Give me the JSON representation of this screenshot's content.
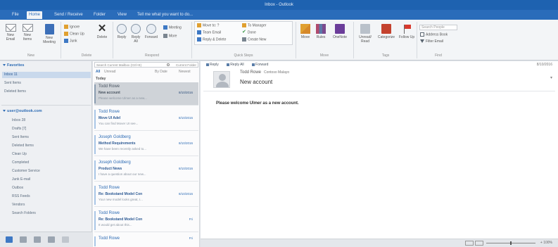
{
  "window": {
    "title": "Inbox - Outlook"
  },
  "tabs": [
    "File",
    "Home",
    "Send / Receive",
    "Folder",
    "View",
    "Tell me what you want to do..."
  ],
  "ribbon": {
    "new_email": "New Email",
    "new_items": "New Items",
    "new_meeting": "New Meeting",
    "ignore": "Ignore",
    "clean_up": "Clean Up",
    "junk": "Junk",
    "delete": "Delete",
    "reply": "Reply",
    "reply_all": "Reply All",
    "forward": "Forward",
    "meeting": "Meeting",
    "more": "More",
    "move_to": "Move to: ?",
    "team_email": "Team Email",
    "reply_delete": "Reply & Delete",
    "to_manager": "To Manager",
    "done": "Done",
    "create_new": "Create New",
    "move": "Move",
    "rules": "Rules",
    "onenote": "OneNote",
    "unread_read": "Unread/ Read",
    "categorize": "Categorize",
    "follow_up": "Follow Up",
    "search_people": "Search People",
    "address_book": "Address Book",
    "filter_email": "Filter Email",
    "groups": [
      "New",
      "Delete",
      "Respond",
      "Quick Steps",
      "Move",
      "Tags",
      "Find"
    ]
  },
  "folders": {
    "favorites_header": "Favorites",
    "favorites": [
      "Inbox 11",
      "Sent Items",
      "Deleted Items"
    ],
    "account_header": "user@outlook.com",
    "account_folders": [
      "Inbox 28",
      "Drafts [7]",
      "Sent Items",
      "Deleted Items",
      "Clean Up",
      "Completed",
      "Customer Service",
      "Junk E-mail",
      "Outbox",
      "RSS Feeds",
      "Vendors",
      "Search Folders"
    ]
  },
  "list": {
    "search_placeholder": "Search Current Mailbox (Ctrl+E)",
    "search_scope": "Current Folder",
    "filter_all": "All",
    "filter_unread": "Unread",
    "sort_by": "By Date",
    "sort_order": "Newest",
    "group_label": "Today",
    "messages": [
      {
        "from": "Todd Rowe",
        "subject": "New account",
        "preview": "Please welcome Ulmer as a new...",
        "date": "8/10/2016"
      },
      {
        "from": "Todd Rowe",
        "subject": "Move UI Adel",
        "preview": "You can find Mover UI see...",
        "date": "8/10/2016"
      },
      {
        "from": "Joseph Goldberg",
        "subject": "Method Requirements",
        "preview": "We have been recently asked to...",
        "date": "8/10/2016"
      },
      {
        "from": "Joseph Goldberg",
        "subject": "Product News",
        "preview": "I have a question about our new...",
        "date": "8/10/2016"
      },
      {
        "from": "Todd Rowe",
        "subject": "Re: Bookstand Model Con",
        "preview": "Your new model looks great, I...",
        "date": "8/10/2016"
      },
      {
        "from": "Todd Rowe",
        "subject": "Re: Bookstand Model Con",
        "preview": "It would get about this...",
        "date": "Fri"
      },
      {
        "from": "Todd Rowe",
        "subject": "",
        "preview": "",
        "date": "Fri"
      }
    ]
  },
  "reading": {
    "actions": [
      "Reply",
      "Reply All",
      "Forward"
    ],
    "date": "8/10/2016",
    "from": "Todd Rowe",
    "to": "Contoso Malayo",
    "subject": "New account",
    "body": "Please welcome Ulmer as a new account."
  },
  "status": {
    "zoom": "+ 100%"
  }
}
